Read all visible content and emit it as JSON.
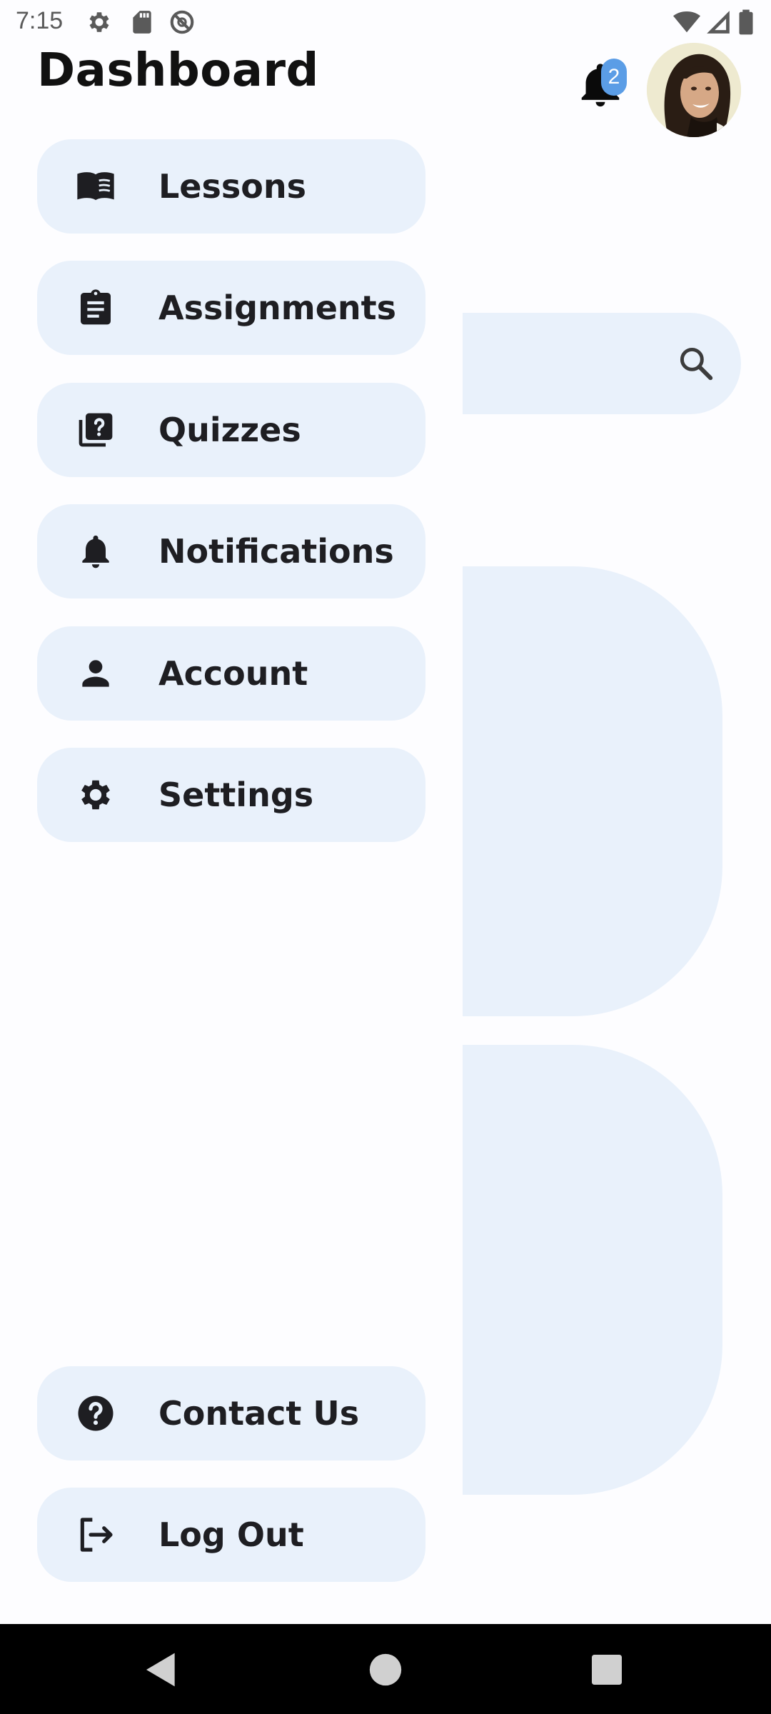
{
  "status_bar": {
    "time": "7:15",
    "icons": [
      "settings-icon",
      "sd-card-icon",
      "do-not-disturb-icon",
      "wifi-icon",
      "cell-signal-icon",
      "battery-icon"
    ]
  },
  "header": {
    "title": "Dashboard",
    "notification_count": "2"
  },
  "menu": {
    "items": [
      {
        "label": "Lessons",
        "icon": "book-open-icon"
      },
      {
        "label": "Assignments",
        "icon": "clipboard-icon"
      },
      {
        "label": "Quizzes",
        "icon": "quiz-icon"
      },
      {
        "label": "Notifications",
        "icon": "bell-icon"
      },
      {
        "label": "Account",
        "icon": "person-icon"
      },
      {
        "label": "Settings",
        "icon": "gear-icon"
      }
    ],
    "footer": [
      {
        "label": "Contact Us",
        "icon": "help-icon"
      },
      {
        "label": "Log Out",
        "icon": "logout-icon"
      }
    ]
  },
  "colors": {
    "menu_background": "#e9f1fb",
    "badge": "#5b9de6",
    "text": "#1e1e22"
  }
}
